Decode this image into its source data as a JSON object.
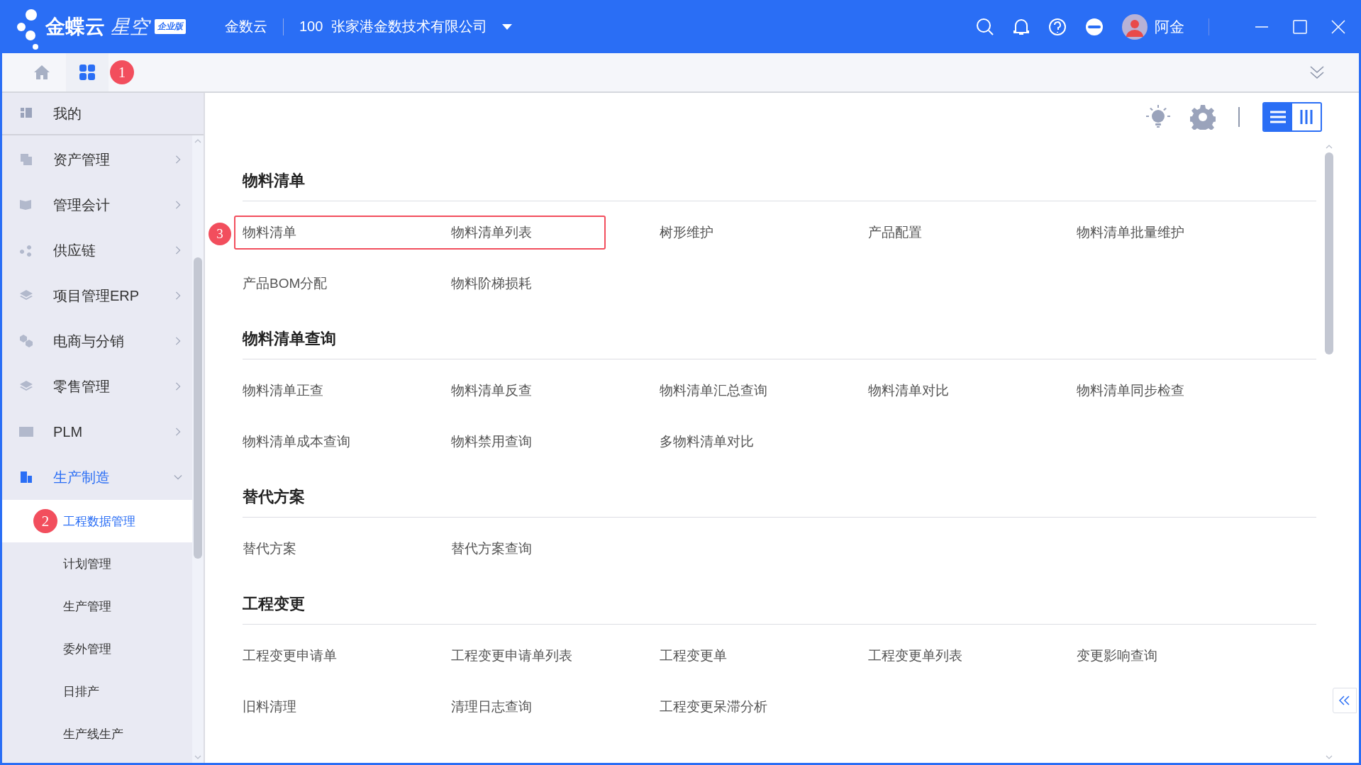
{
  "header": {
    "brand": "金蝶云",
    "product": "星空",
    "edition": "企业版",
    "tenant": "金数云",
    "org_code": "100",
    "org_name": "张家港金数技术有限公司",
    "user": "阿金"
  },
  "tabs": [
    {
      "kind": "home",
      "selected": false
    },
    {
      "kind": "apps",
      "selected": true,
      "badge": "1"
    }
  ],
  "sidebar": {
    "items": [
      {
        "label": "我的",
        "kind": "pinned",
        "selected": false
      },
      {
        "label": "资产管理",
        "kind": "group",
        "selected": false,
        "expanded": false
      },
      {
        "label": "管理会计",
        "kind": "group",
        "selected": false,
        "expanded": false
      },
      {
        "label": "供应链",
        "kind": "group",
        "selected": false,
        "expanded": false
      },
      {
        "label": "项目管理ERP",
        "kind": "group",
        "selected": false,
        "expanded": false
      },
      {
        "label": "电商与分销",
        "kind": "group",
        "selected": false,
        "expanded": false
      },
      {
        "label": "零售管理",
        "kind": "group",
        "selected": false,
        "expanded": false
      },
      {
        "label": "PLM",
        "kind": "group",
        "selected": false,
        "expanded": false
      },
      {
        "label": "生产制造",
        "kind": "group",
        "selected": true,
        "expanded": true,
        "children": [
          {
            "label": "工程数据管理",
            "selected": true,
            "badge": "2"
          },
          {
            "label": "计划管理",
            "selected": false
          },
          {
            "label": "生产管理",
            "selected": false
          },
          {
            "label": "委外管理",
            "selected": false
          },
          {
            "label": "日排产",
            "selected": false
          },
          {
            "label": "生产线生产",
            "selected": false
          }
        ]
      }
    ]
  },
  "toolbar": {
    "view_modes": [
      {
        "kind": "list",
        "selected": true
      },
      {
        "kind": "columns",
        "selected": false
      }
    ]
  },
  "sections": [
    {
      "title": "物料清单",
      "callout_badge": "3",
      "items": [
        {
          "label": "物料清单",
          "highlighted": true
        },
        {
          "label": "物料清单列表",
          "highlighted": true
        },
        {
          "label": "树形维护",
          "highlighted": false
        },
        {
          "label": "产品配置",
          "highlighted": false
        },
        {
          "label": "物料清单批量维护",
          "highlighted": false
        },
        {
          "label": "产品BOM分配",
          "highlighted": false
        },
        {
          "label": "物料阶梯损耗",
          "highlighted": false
        }
      ]
    },
    {
      "title": "物料清单查询",
      "items": [
        {
          "label": "物料清单正查",
          "highlighted": false
        },
        {
          "label": "物料清单反查",
          "highlighted": false
        },
        {
          "label": "物料清单汇总查询",
          "highlighted": false
        },
        {
          "label": "物料清单对比",
          "highlighted": false
        },
        {
          "label": "物料清单同步检查",
          "highlighted": false
        },
        {
          "label": "物料清单成本查询",
          "highlighted": false
        },
        {
          "label": "物料禁用查询",
          "highlighted": false
        },
        {
          "label": "多物料清单对比",
          "highlighted": false
        }
      ]
    },
    {
      "title": "替代方案",
      "items": [
        {
          "label": "替代方案",
          "highlighted": false
        },
        {
          "label": "替代方案查询",
          "highlighted": false
        }
      ]
    },
    {
      "title": "工程变更",
      "items": [
        {
          "label": "工程变更申请单",
          "highlighted": false
        },
        {
          "label": "工程变更申请单列表",
          "highlighted": false
        },
        {
          "label": "工程变更单",
          "highlighted": false
        },
        {
          "label": "工程变更单列表",
          "highlighted": false
        },
        {
          "label": "变更影响查询",
          "highlighted": false
        },
        {
          "label": "旧料清理",
          "highlighted": false
        },
        {
          "label": "清理日志查询",
          "highlighted": false
        },
        {
          "label": "工程变更呆滞分析",
          "highlighted": false
        }
      ]
    }
  ]
}
